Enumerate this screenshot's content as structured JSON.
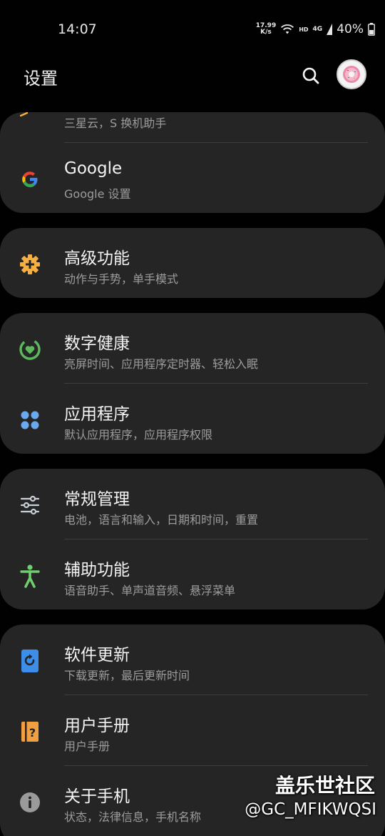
{
  "status_bar": {
    "time": "14:07",
    "net_speed_value": "17.99",
    "net_speed_unit": "K/s",
    "hd_label": "HD",
    "network_label": "4G",
    "battery_percent": "40%"
  },
  "header": {
    "title": "设置",
    "search_icon": "search-icon",
    "avatar_icon": "avatar"
  },
  "partial_item": {
    "subtitle": "三星云，S 换机助手"
  },
  "groups": [
    {
      "items": [
        {
          "title": "Google",
          "subtitle": "Google 设置",
          "icon": "google-icon",
          "color": "#4285f4"
        }
      ]
    },
    {
      "items": [
        {
          "title": "高级功能",
          "subtitle": "动作与手势，单手模式",
          "icon": "puzzle-gear-icon",
          "color": "#f5b041"
        }
      ]
    },
    {
      "items": [
        {
          "title": "数字健康",
          "subtitle": "亮屏时间、应用程序定时器、轻松入眠",
          "icon": "digital-wellbeing-icon",
          "color": "#5cb85c"
        },
        {
          "title": "应用程序",
          "subtitle": "默认应用程序，应用程序权限",
          "icon": "apps-icon",
          "color": "#6aa8f0"
        }
      ]
    },
    {
      "items": [
        {
          "title": "常规管理",
          "subtitle": "电池，语言和输入，日期和时间，重置",
          "icon": "sliders-icon",
          "color": "#c9d0d8"
        },
        {
          "title": "辅助功能",
          "subtitle": "语音助手、单声道音频、悬浮菜单",
          "icon": "accessibility-icon",
          "color": "#6fcf6f"
        }
      ]
    },
    {
      "items": [
        {
          "title": "软件更新",
          "subtitle": "下载更新，最后更新时间",
          "icon": "software-update-icon",
          "color": "#3d8ee8"
        },
        {
          "title": "用户手册",
          "subtitle": "用户手册",
          "icon": "user-manual-icon",
          "color": "#f0a040"
        },
        {
          "title": "关于手机",
          "subtitle": "状态，法律信息，手机名称",
          "icon": "info-icon",
          "color": "#9a9a9a"
        }
      ]
    }
  ],
  "watermark": {
    "brand": "盖乐世社区",
    "user": "@GC_MFIKWQSI"
  }
}
